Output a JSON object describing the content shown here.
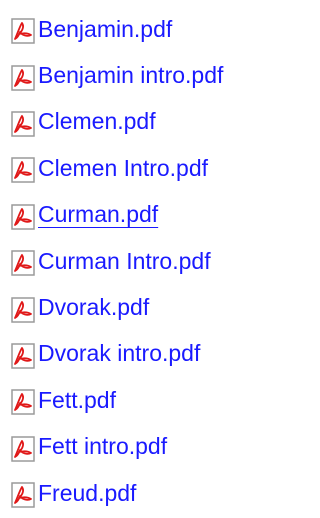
{
  "colors": {
    "link": "#1a1aff",
    "icon_red": "#e01818",
    "icon_border": "#b0b0b0"
  },
  "icon": "pdf-file-icon",
  "files": [
    {
      "label": "Benjamin.pdf"
    },
    {
      "label": "Benjamin intro.pdf"
    },
    {
      "label": "Clemen.pdf"
    },
    {
      "label": "Clemen Intro.pdf"
    },
    {
      "label": "Curman.pdf",
      "hovered": true
    },
    {
      "label": "Curman Intro.pdf"
    },
    {
      "label": "Dvorak.pdf"
    },
    {
      "label": "Dvorak intro.pdf"
    },
    {
      "label": "Fett.pdf"
    },
    {
      "label": "Fett intro.pdf"
    },
    {
      "label": "Freud.pdf"
    }
  ]
}
